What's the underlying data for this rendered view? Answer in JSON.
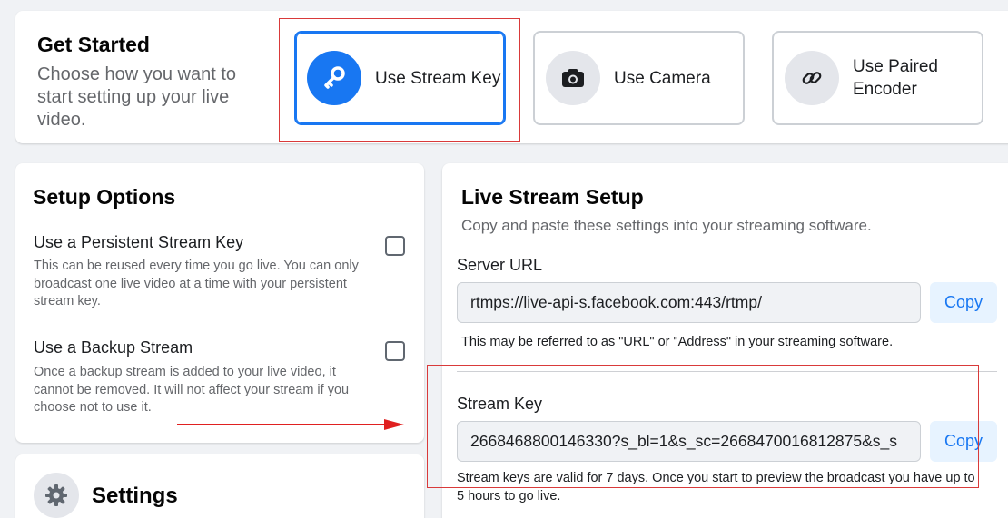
{
  "get_started": {
    "title": "Get Started",
    "subtitle": "Choose how you want to start setting up your live video.",
    "options": [
      {
        "label": "Use Stream Key",
        "icon": "key-icon",
        "selected": true
      },
      {
        "label": "Use Camera",
        "icon": "camera-icon",
        "selected": false
      },
      {
        "label": "Use Paired Encoder",
        "icon": "link-icon",
        "selected": false
      }
    ]
  },
  "setup_options": {
    "title": "Setup Options",
    "items": [
      {
        "title": "Use a Persistent Stream Key",
        "description": "This can be reused every time you go live. You can only broadcast one live video at a time with your persistent stream key.",
        "checked": false
      },
      {
        "title": "Use a Backup Stream",
        "description": "Once a backup stream is added to your live video, it cannot be removed. It will not affect your stream if you choose not to use it.",
        "checked": false
      }
    ]
  },
  "settings": {
    "title": "Settings",
    "icon": "gear-icon"
  },
  "live_stream_setup": {
    "title": "Live Stream Setup",
    "subtitle": "Copy and paste these settings into your streaming software.",
    "server_url": {
      "label": "Server URL",
      "value": "rtmps://live-api-s.facebook.com:443/rtmp/",
      "copy_label": "Copy",
      "hint": "This may be referred to as \"URL\" or \"Address\" in your streaming software."
    },
    "stream_key": {
      "label": "Stream Key",
      "value": "2668468800146330?s_bl=1&s_sc=2668470016812875&s_s",
      "copy_label": "Copy",
      "hint": "Stream keys are valid for 7 days. Once you start to preview the broadcast you have up to 5 hours to go live."
    }
  },
  "colors": {
    "accent": "#1877f2",
    "annotation_red": "#d93a3a"
  }
}
